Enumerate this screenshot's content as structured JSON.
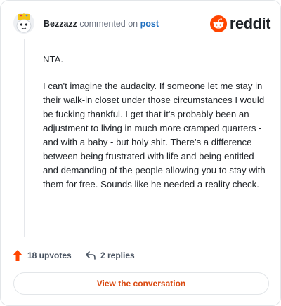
{
  "comment": {
    "username": "Bezzazz",
    "action_text": "commented on",
    "post_link": "post",
    "paragraphs": [
      "NTA.",
      "I can't imagine the audacity. If someone let me stay in their walk-in closet under those circumstances I would be fucking thankful. I get that it's probably been an adjustment to living in much more cramped quarters - and with a baby - but holy shit. There's a difference between being frustrated with life and being entitled and demanding of the people allowing you to stay with them for free. Sounds like he needed a reality check."
    ]
  },
  "brand": {
    "logo_text": "reddit",
    "accent": "#ff4500"
  },
  "stats": {
    "upvotes": "18 upvotes",
    "replies": "2 replies"
  },
  "cta": {
    "label": "View the conversation"
  },
  "colors": {
    "link": "#1f6fbf",
    "cta_text": "#d9480f",
    "upvote": "#ff4500"
  },
  "icons": [
    "avatar",
    "reddit-logo-icon",
    "upvote-arrow-icon",
    "reply-icon"
  ]
}
